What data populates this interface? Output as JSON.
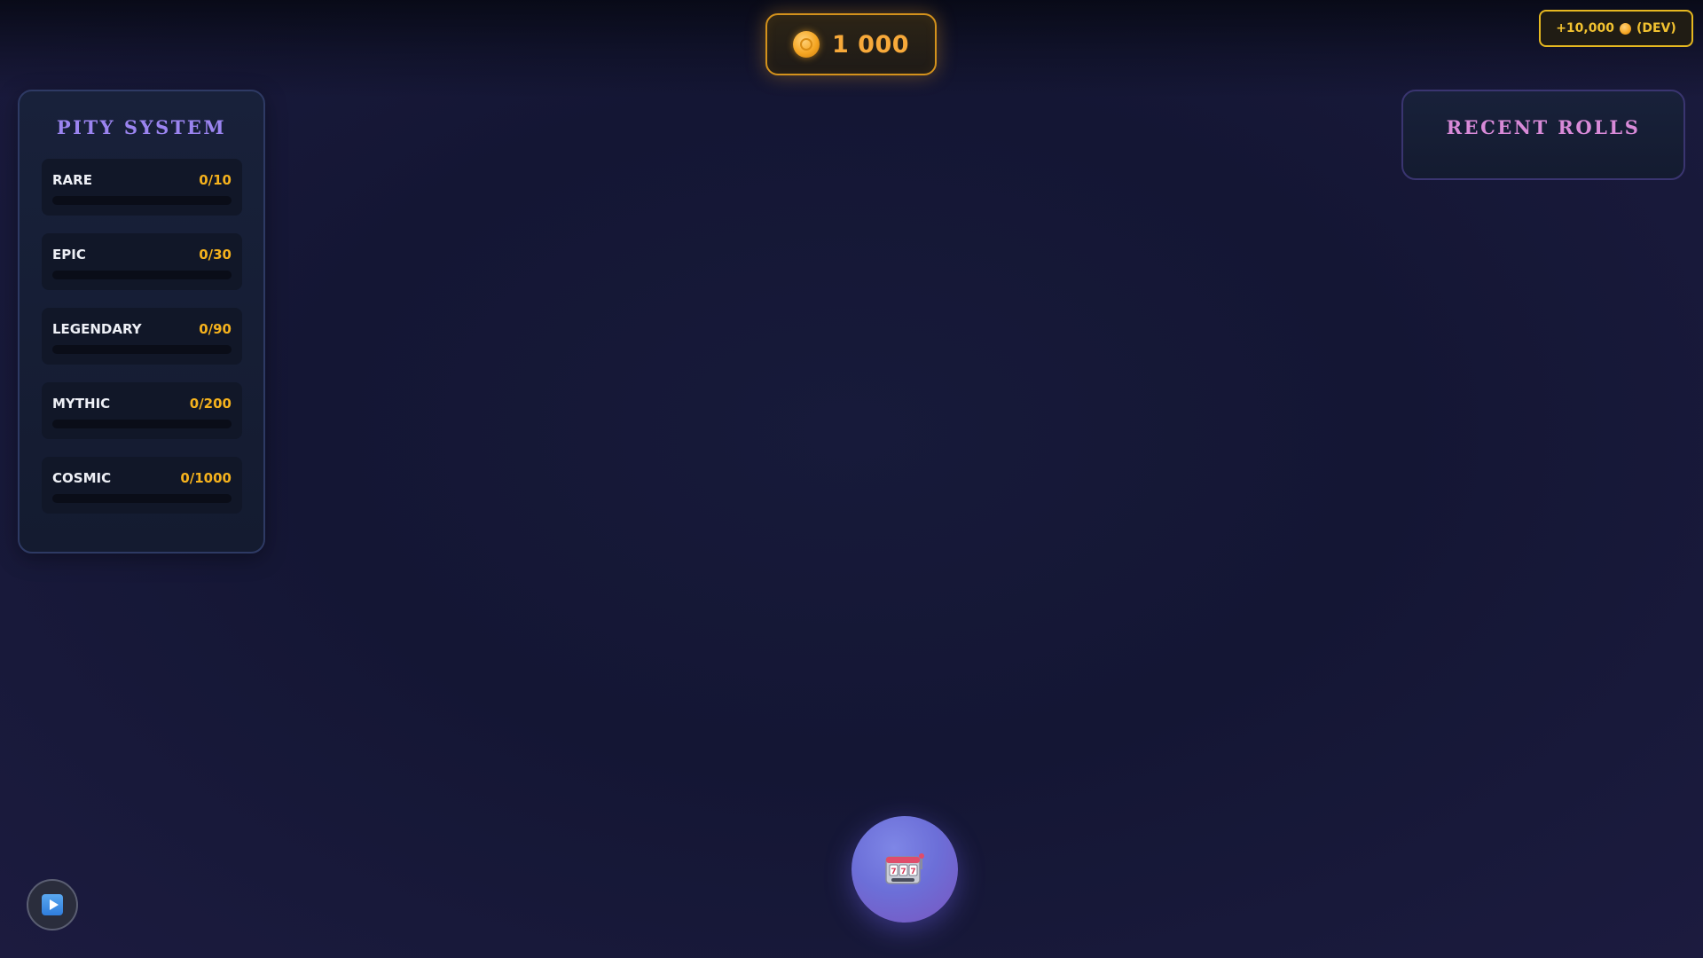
{
  "balance": {
    "value": "1 000",
    "icon": "coin-icon"
  },
  "dev_button": {
    "prefix": "+10,000",
    "suffix": "(DEV)",
    "icon": "coin-icon"
  },
  "pity": {
    "title": "PITY SYSTEM",
    "items": [
      {
        "name": "RARE",
        "count": "0/10",
        "progress": 0
      },
      {
        "name": "EPIC",
        "count": "0/30",
        "progress": 0
      },
      {
        "name": "LEGENDARY",
        "count": "0/90",
        "progress": 0
      },
      {
        "name": "MYTHIC",
        "count": "0/200",
        "progress": 0
      },
      {
        "name": "COSMIC",
        "count": "0/1000",
        "progress": 0
      }
    ]
  },
  "recent": {
    "title": "RECENT ROLLS"
  },
  "roll_button": {
    "icon": "slot-machine-icon"
  },
  "play_button": {
    "icon": "play-icon"
  },
  "colors": {
    "accent_gold": "#f5b21d",
    "accent_purple": "#9b84f0",
    "accent_pink": "#d88ad8",
    "dev_yellow": "#f2c230"
  }
}
